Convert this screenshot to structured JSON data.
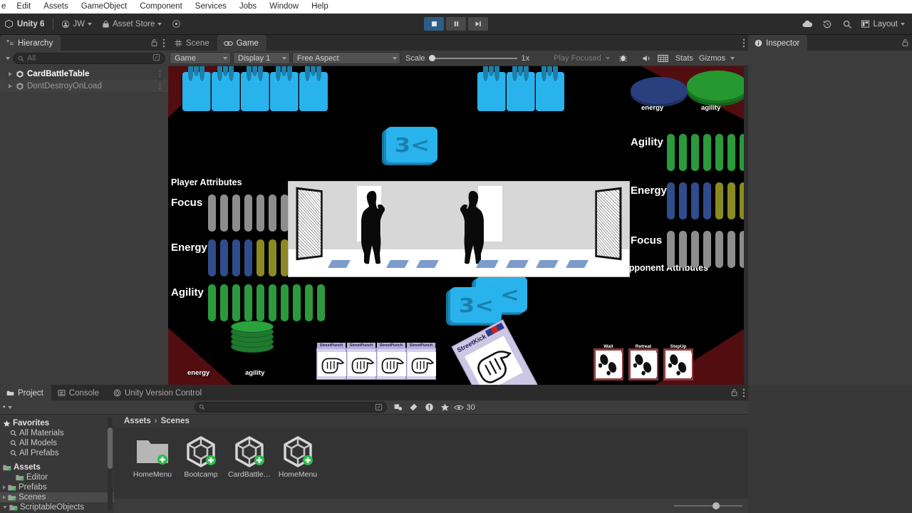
{
  "menubar": {
    "items": [
      "e",
      "Edit",
      "Assets",
      "GameObject",
      "Component",
      "Services",
      "Jobs",
      "Window",
      "Help"
    ]
  },
  "toolbar": {
    "unity_version": "Unity 6",
    "account": "JW",
    "asset_store": "Asset Store",
    "cloud_icon": "cloud-icon",
    "history_icon": "history-icon",
    "search_icon": "search-icon",
    "layout_label": "Layout",
    "play_icon": "stop-square-icon",
    "pause_icon": "pause-icon",
    "step_icon": "step-forward-icon"
  },
  "hierarchy": {
    "tab_label": "Hierarchy",
    "search_placeholder": "All",
    "lock_icon": "lock-icon",
    "menu_icon": "kebab-menu-icon",
    "items": [
      {
        "label": "CardBattleTable",
        "dim": false
      },
      {
        "label": "DontDestroyOnLoad",
        "dim": true
      }
    ]
  },
  "gameview": {
    "tabs": [
      {
        "label": "Scene",
        "icon": "grid-icon",
        "active": false
      },
      {
        "label": "Game",
        "icon": "gamepad-icon",
        "active": true
      }
    ],
    "menu_icon": "kebab-menu-icon",
    "target_display_mode": "Game",
    "display": "Display 1",
    "aspect": "Free Aspect",
    "scale_label": "Scale",
    "scale_value": "1x",
    "play_mode": "Play Focused",
    "debug_icon": "bug-icon",
    "mute_icon": "mute-audio-icon",
    "grid_icon": "grid-overlay-icon",
    "stats_label": "Stats",
    "gizmos_label": "Gizmos"
  },
  "inspector": {
    "tab_label": "Inspector",
    "info_icon": "info-icon",
    "lock_icon": "lock-icon"
  },
  "project": {
    "tabs": [
      {
        "label": "Project",
        "icon": "folder-icon",
        "active": true
      },
      {
        "label": "Console",
        "icon": "console-icon",
        "active": false
      },
      {
        "label": "Unity Version Control",
        "icon": "version-control-icon",
        "active": false
      }
    ],
    "lock_icon": "lock-icon",
    "menu_icon": "kebab-menu-icon",
    "search_placeholder": "",
    "thumbnail_count": "30",
    "eye_icon": "eye-icon",
    "favorites": {
      "label": "Favorites",
      "items": [
        "All Materials",
        "All Models",
        "All Prefabs"
      ]
    },
    "assets_tree": {
      "label": "Assets",
      "items": [
        {
          "label": "Editor",
          "expandable": false,
          "selected": false
        },
        {
          "label": "Prefabs",
          "expandable": true,
          "selected": false
        },
        {
          "label": "Scenes",
          "expandable": true,
          "selected": true
        },
        {
          "label": "ScriptableObjects",
          "expandable": true,
          "selected": false
        }
      ]
    },
    "breadcrumb": [
      "Assets",
      "Scenes"
    ],
    "grid_items": [
      {
        "name": "HomeMenu",
        "type": "folder"
      },
      {
        "name": "Bootcamp",
        "type": "scene"
      },
      {
        "name": "CardBattle…",
        "type": "scene"
      },
      {
        "name": "HomeMenu",
        "type": "scene"
      }
    ]
  },
  "game": {
    "player_attributes_label": "Player Attributes",
    "opponent_attributes_label": "Opponent Attributes",
    "player_rows": [
      {
        "label": "Focus",
        "color": "#8d8d8d",
        "count": 10,
        "filled": 0,
        "fill_color": "#8d8d8d"
      },
      {
        "label": "Energy",
        "color": "#2f4d8c",
        "count": 10,
        "filled": 4,
        "fill_color": "#8a8a22"
      },
      {
        "label": "Agility",
        "color": "#2a9a3c",
        "count": 10,
        "filled": 10,
        "fill_color": "#2a9a3c"
      }
    ],
    "opponent_rows": [
      {
        "label": "Agility",
        "color": "#2a9a3c",
        "count": 10,
        "filled": 10,
        "fill_color": "#2a9a3c"
      },
      {
        "label": "Energy",
        "color": "#2f4d8c",
        "count": 10,
        "filled": 4,
        "fill_color": "#8a8a22"
      },
      {
        "label": "Focus",
        "color": "#8d8d8d",
        "count": 10,
        "filled": 0,
        "fill_color": "#8d8d8d"
      }
    ],
    "player_chips": [
      {
        "label": "energy",
        "color": "#1f7a2f"
      },
      {
        "label": "agility",
        "color": "#1f7a2f"
      }
    ],
    "opponent_chips": [
      {
        "label": "energy",
        "color": "#2a3f7e"
      },
      {
        "label": "agility",
        "color": "#2a9a3c"
      }
    ],
    "player_hand": [
      "StreetPunch",
      "StreetPunch",
      "StreetPunch",
      "StreetPunch"
    ],
    "opponent_hand": [
      "Wait",
      "Retreat",
      "StepUp"
    ],
    "played_card": "StreetKick",
    "facedown_glyph": "3<"
  },
  "colors": {
    "accent_blue": "#2c5d87",
    "panel_bg": "#383838",
    "toolbar_bg": "#2b2b2b",
    "card_blue": "#29b3ec",
    "table_red": "#520d11"
  }
}
